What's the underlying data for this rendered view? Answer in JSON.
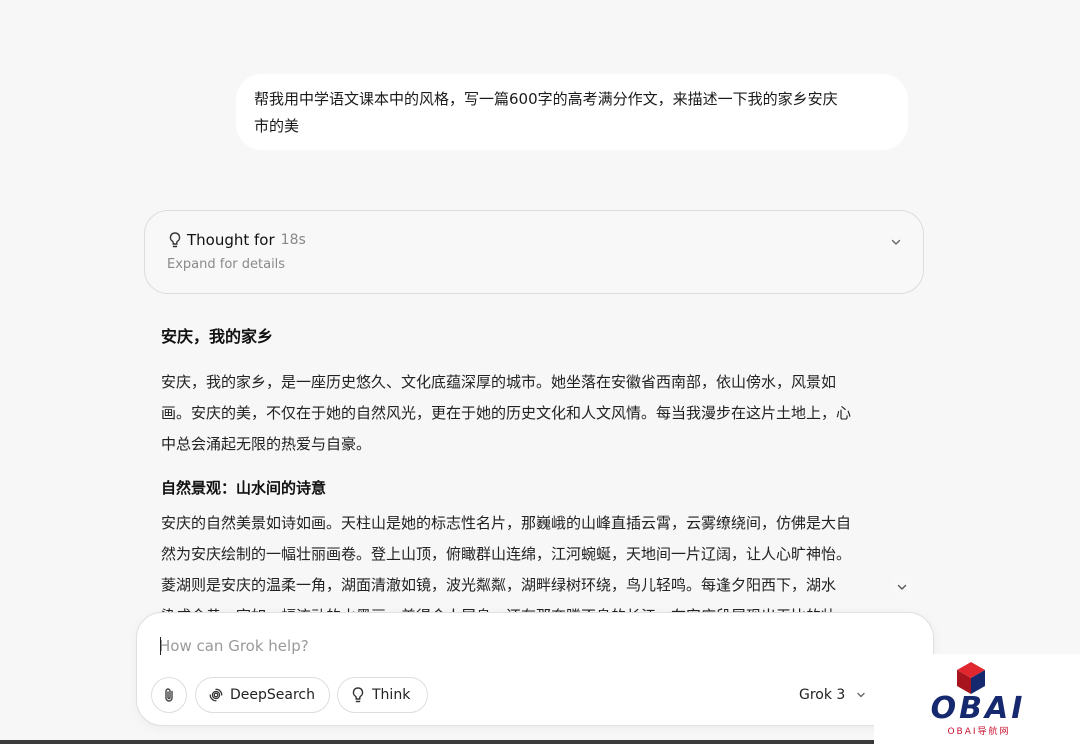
{
  "chat": {
    "user_message_lines": [
      "帮我用中学语文课本中的风格，写一篇600字的高考满分作文，来描述一下我的家乡安庆",
      "市的美"
    ]
  },
  "thought": {
    "title": "Thought for",
    "duration": "18s",
    "subtitle": "Expand for details"
  },
  "answer": {
    "title": "安庆，我的家乡",
    "intro_lines": [
      "安庆，我的家乡，是一座历史悠久、文化底蕴深厚的城市。她坐落在安徽省西南部，依山傍水，风景如",
      "画。安庆的美，不仅在于她的自然风光，更在于她的历史文化和人文风情。每当我漫步在这片土地上，心",
      "中总会涌起无限的热爱与自豪。"
    ],
    "section1_heading": "自然景观：山水间的诗意",
    "section1_lines": [
      "安庆的自然美景如诗如画。天柱山是她的标志性名片，那巍峨的山峰直插云霄，云雾缭绕间，仿佛是大自",
      "然为安庆绘制的一幅壮丽画卷。登上山顶，俯瞰群山连绵，江河蜿蜒，天地间一片辽阔，让人心旷神怡。",
      "菱湖则是安庆的温柔一角，湖面清澈如镜，波光粼粼，湖畔绿树环绕，鸟儿轻鸣。每逢夕阳西下，湖水",
      "染成金黄，宛如一幅流动的水墨画，美得令人屏息。还有那奔腾不息的长江，在安庆段展现出无比的壮"
    ]
  },
  "composer": {
    "placeholder": "How can Grok help?",
    "deepsearch_label": "DeepSearch",
    "think_label": "Think",
    "model_label": "Grok 3"
  },
  "watermark": {
    "brand": "OBAI",
    "tagline": "OBAI导航网",
    "colors": {
      "blue": "#16296e",
      "red": "#c8102e"
    }
  },
  "icons": {
    "thought": "lightbulb-icon",
    "expand": "chevron-down-icon",
    "attach": "paperclip-icon",
    "deepsearch": "swirl-icon",
    "think": "lightbulb-icon",
    "model": "chevron-down-icon"
  }
}
